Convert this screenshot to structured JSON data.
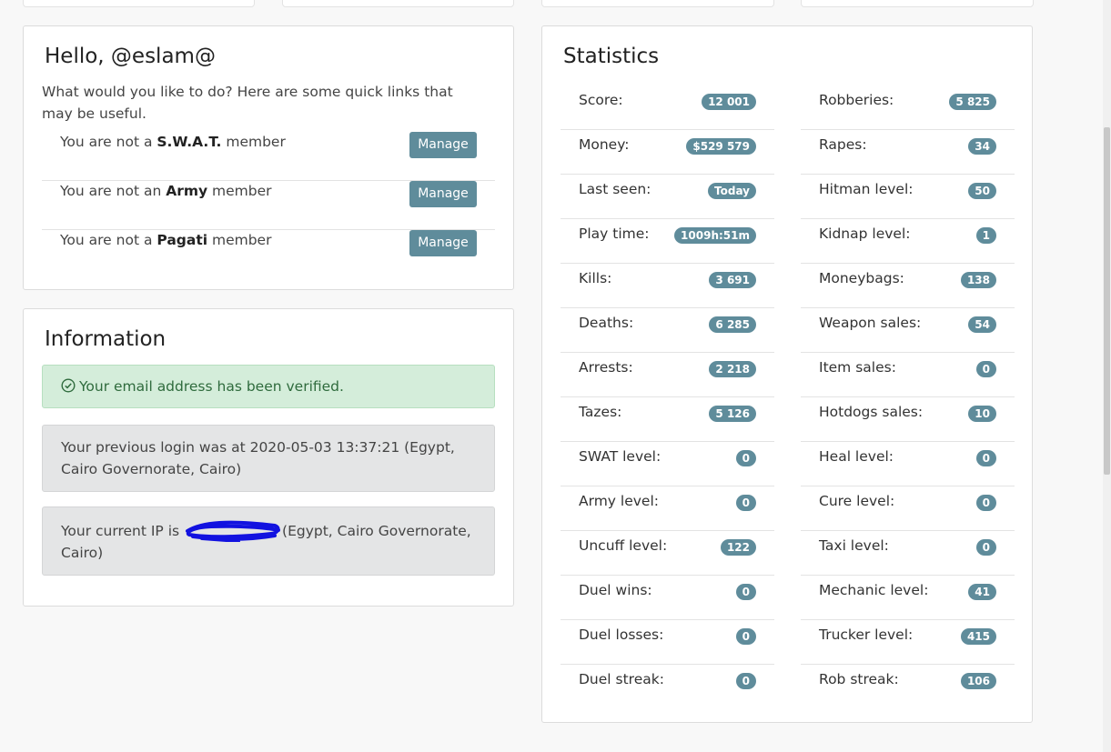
{
  "greeting": "Hello, @eslam@",
  "intro": "What would you like to do? Here are some quick links that may be useful.",
  "memberships": [
    {
      "prefix": "You are not a ",
      "group": "S.W.A.T.",
      "suffix": " member",
      "button": "Manage"
    },
    {
      "prefix": "You are not an ",
      "group": "Army",
      "suffix": " member",
      "button": "Manage"
    },
    {
      "prefix": "You are not a ",
      "group": "Pagati",
      "suffix": " member",
      "button": "Manage"
    }
  ],
  "information": {
    "title": "Information",
    "verified": "Your email address has been verified.",
    "previous_login": "Your previous login was at 2020-05-03 13:37:21 (Egypt, Cairo Governorate, Cairo)",
    "current_ip_prefix": "Your current IP is ",
    "current_ip_suffix": "(Egypt, Cairo Governorate, Cairo)"
  },
  "statistics": {
    "title": "Statistics",
    "left": [
      {
        "label": "Score:",
        "value": "12 001"
      },
      {
        "label": "Money:",
        "value": "$529 579"
      },
      {
        "label": "Last seen:",
        "value": "Today"
      },
      {
        "label": "Play time:",
        "value": "1009h:51m"
      },
      {
        "label": "Kills:",
        "value": "3 691"
      },
      {
        "label": "Deaths:",
        "value": "6 285"
      },
      {
        "label": "Arrests:",
        "value": "2 218"
      },
      {
        "label": "Tazes:",
        "value": "5 126"
      },
      {
        "label": "SWAT level:",
        "value": "0"
      },
      {
        "label": "Army level:",
        "value": "0"
      },
      {
        "label": "Uncuff level:",
        "value": "122"
      },
      {
        "label": "Duel wins:",
        "value": "0"
      },
      {
        "label": "Duel losses:",
        "value": "0"
      },
      {
        "label": "Duel streak:",
        "value": "0"
      }
    ],
    "right": [
      {
        "label": "Robberies:",
        "value": "5 825"
      },
      {
        "label": "Rapes:",
        "value": "34"
      },
      {
        "label": "Hitman level:",
        "value": "50"
      },
      {
        "label": "Kidnap level:",
        "value": "1"
      },
      {
        "label": "Moneybags:",
        "value": "138"
      },
      {
        "label": "Weapon sales:",
        "value": "54"
      },
      {
        "label": "Item sales:",
        "value": "0"
      },
      {
        "label": "Hotdogs sales:",
        "value": "10"
      },
      {
        "label": "Heal level:",
        "value": "0"
      },
      {
        "label": "Cure level:",
        "value": "0"
      },
      {
        "label": "Taxi level:",
        "value": "0"
      },
      {
        "label": "Mechanic level:",
        "value": "41"
      },
      {
        "label": "Trucker level:",
        "value": "415"
      },
      {
        "label": "Rob streak:",
        "value": "106"
      }
    ]
  },
  "colors": {
    "badge": "#5f8c9b",
    "button": "#5f8c9b",
    "success_bg": "#d4edda",
    "redaction": "#1212e0"
  }
}
